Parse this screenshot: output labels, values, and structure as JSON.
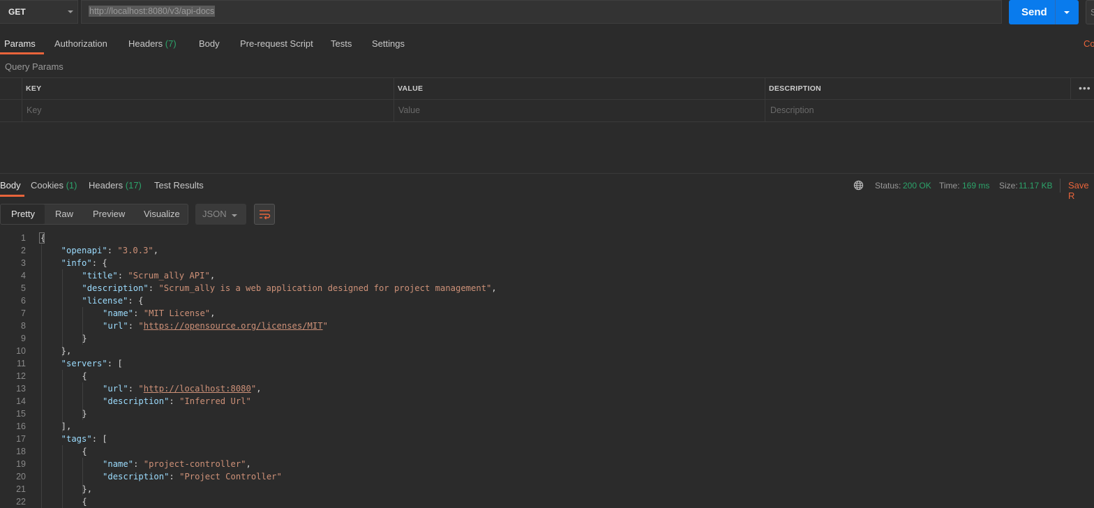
{
  "request": {
    "method": "GET",
    "url": "http://localhost:8080/v3/api-docs",
    "send_label": "Send",
    "save_partial": "S"
  },
  "request_tabs": [
    {
      "label": "Params",
      "count": ""
    },
    {
      "label": "Authorization",
      "count": ""
    },
    {
      "label": "Headers",
      "count": "(7)"
    },
    {
      "label": "Body",
      "count": ""
    },
    {
      "label": "Pre-request Script",
      "count": ""
    },
    {
      "label": "Tests",
      "count": ""
    },
    {
      "label": "Settings",
      "count": ""
    }
  ],
  "cookies_link_partial": "Co",
  "query_params": {
    "title": "Query Params",
    "columns": [
      "KEY",
      "VALUE",
      "DESCRIPTION"
    ],
    "placeholders": {
      "key": "Key",
      "value": "Value",
      "description": "Description"
    }
  },
  "response_tabs": [
    {
      "label": "Body",
      "count": ""
    },
    {
      "label": "Cookies",
      "count": "(1)"
    },
    {
      "label": "Headers",
      "count": "(17)"
    },
    {
      "label": "Test Results",
      "count": ""
    }
  ],
  "response_meta": {
    "status_label": "Status:",
    "status_value": "200 OK",
    "time_label": "Time:",
    "time_value": "169 ms",
    "size_label": "Size:",
    "size_value": "11.17 KB",
    "save_response_partial": "Save R"
  },
  "view_modes": [
    "Pretty",
    "Raw",
    "Preview",
    "Visualize"
  ],
  "format": "JSON",
  "code_lines": [
    [
      [
        "p",
        "{"
      ]
    ],
    [
      [
        "k",
        "\"openapi\""
      ],
      [
        "p",
        ": "
      ],
      [
        "s",
        "\"3.0.3\""
      ],
      [
        "p",
        ","
      ]
    ],
    [
      [
        "k",
        "\"info\""
      ],
      [
        "p",
        ": {"
      ]
    ],
    [
      [
        "k",
        "\"title\""
      ],
      [
        "p",
        ": "
      ],
      [
        "s",
        "\"Scrum_ally API\""
      ],
      [
        "p",
        ","
      ]
    ],
    [
      [
        "k",
        "\"description\""
      ],
      [
        "p",
        ": "
      ],
      [
        "s",
        "\"Scrum_ally is a web application designed for project management\""
      ],
      [
        "p",
        ","
      ]
    ],
    [
      [
        "k",
        "\"license\""
      ],
      [
        "p",
        ": {"
      ]
    ],
    [
      [
        "k",
        "\"name\""
      ],
      [
        "p",
        ": "
      ],
      [
        "s",
        "\"MIT License\""
      ],
      [
        "p",
        ","
      ]
    ],
    [
      [
        "k",
        "\"url\""
      ],
      [
        "p",
        ": "
      ],
      [
        "s",
        "\""
      ],
      [
        "u",
        "https://opensource.org/licenses/MIT"
      ],
      [
        "s",
        "\""
      ]
    ],
    [
      [
        "p",
        "}"
      ]
    ],
    [
      [
        "p",
        "},"
      ]
    ],
    [
      [
        "k",
        "\"servers\""
      ],
      [
        "p",
        ": ["
      ]
    ],
    [
      [
        "p",
        "{"
      ]
    ],
    [
      [
        "k",
        "\"url\""
      ],
      [
        "p",
        ": "
      ],
      [
        "s",
        "\""
      ],
      [
        "u",
        "http://localhost:8080"
      ],
      [
        "s",
        "\""
      ],
      [
        "p",
        ","
      ]
    ],
    [
      [
        "k",
        "\"description\""
      ],
      [
        "p",
        ": "
      ],
      [
        "s",
        "\"Inferred Url\""
      ]
    ],
    [
      [
        "p",
        "}"
      ]
    ],
    [
      [
        "p",
        "],"
      ]
    ],
    [
      [
        "k",
        "\"tags\""
      ],
      [
        "p",
        ": ["
      ]
    ],
    [
      [
        "p",
        "{"
      ]
    ],
    [
      [
        "k",
        "\"name\""
      ],
      [
        "p",
        ": "
      ],
      [
        "s",
        "\"project-controller\""
      ],
      [
        "p",
        ","
      ]
    ],
    [
      [
        "k",
        "\"description\""
      ],
      [
        "p",
        ": "
      ],
      [
        "s",
        "\"Project Controller\""
      ]
    ],
    [
      [
        "p",
        "},"
      ]
    ],
    [
      [
        "p",
        "{"
      ]
    ]
  ],
  "line_numbers": [
    "1",
    "2",
    "3",
    "4",
    "5",
    "6",
    "7",
    "8",
    "9",
    "10",
    "11",
    "12",
    "13",
    "14",
    "15",
    "16",
    "17",
    "18",
    "19",
    "20",
    "21",
    "22"
  ]
}
